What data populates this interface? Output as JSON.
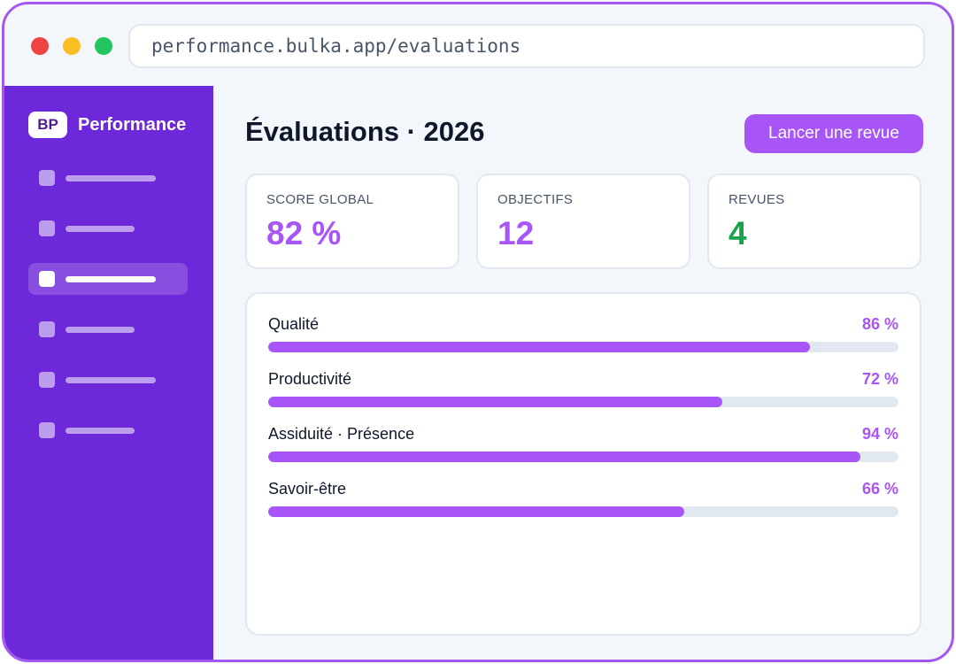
{
  "browser": {
    "url": "performance.bulka.app/evaluations"
  },
  "sidebar": {
    "brand_badge": "BP",
    "brand_name": "Performance",
    "active_index": 2
  },
  "header": {
    "title": "Évaluations · 2026",
    "cta_label": "Lancer une revue"
  },
  "stats": [
    {
      "label": "SCORE GLOBAL",
      "value": "82 %",
      "color": "#a855f7"
    },
    {
      "label": "OBJECTIFS",
      "value": "12",
      "color": "#a855f7"
    },
    {
      "label": "REVUES",
      "value": "4",
      "color": "#16a34a"
    }
  ],
  "metrics": [
    {
      "label": "Qualité",
      "value_text": "86 %",
      "percent": 86
    },
    {
      "label": "Productivité",
      "value_text": "72 %",
      "percent": 72
    },
    {
      "label": "Assiduité · Présence",
      "value_text": "94 %",
      "percent": 94
    },
    {
      "label": "Savoir-être",
      "value_text": "66 %",
      "percent": 66
    }
  ],
  "colors": {
    "accent": "#a855f7",
    "sidebar": "#6d28d9",
    "success": "#16a34a"
  }
}
